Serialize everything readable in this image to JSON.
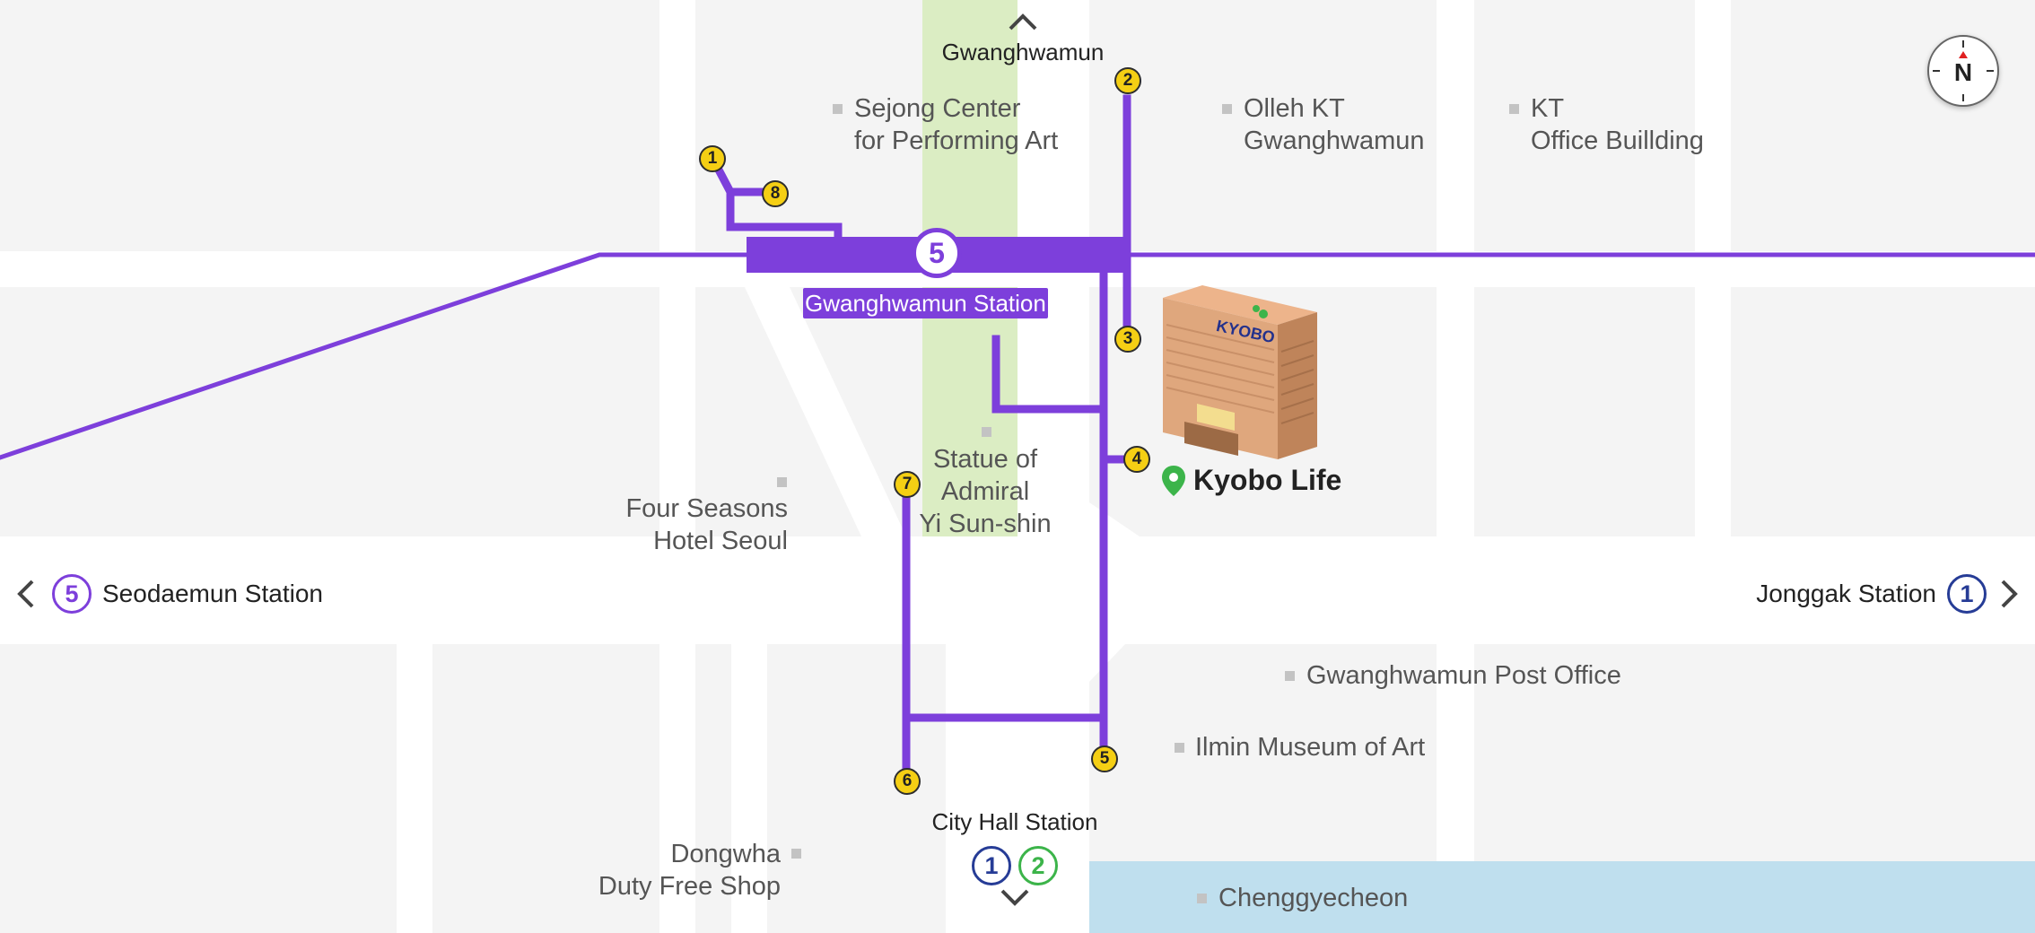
{
  "colors": {
    "line5": "#7d3fdb",
    "line1": "#263c96",
    "line2": "#3cb44a",
    "exit_fill": "#f5cf14",
    "park": "#dbedc3",
    "river": "#bfdfee",
    "road": "#ffffff",
    "block": "#f4f4f4",
    "pin": "#3cb44a"
  },
  "map": {
    "north_label": "N",
    "station": {
      "line": "5",
      "name": "Gwanghwamun Station"
    },
    "target": {
      "name": "Kyobo Life",
      "building_sign": "KYOBO",
      "icon": "map-pin-icon"
    },
    "top_nav": {
      "label": "Gwanghwamun",
      "icon": "chevron-up-icon"
    },
    "bottom_nav": {
      "label": "City Hall Station",
      "lines": [
        "1",
        "2"
      ],
      "icon": "chevron-down-icon"
    },
    "left_nav": {
      "label": "Seodaemun Station",
      "line": "5",
      "icon": "chevron-left-icon"
    },
    "right_nav": {
      "label": "Jonggak Station",
      "line": "1",
      "icon": "chevron-right-icon"
    },
    "exits": [
      "1",
      "2",
      "3",
      "4",
      "5",
      "6",
      "7",
      "8"
    ],
    "landmarks": [
      {
        "name": "Sejong Center",
        "name2": "for Performing Art"
      },
      {
        "name": "Olleh KT",
        "name2": "Gwanghwamun"
      },
      {
        "name": "KT",
        "name2": "Office Buillding"
      },
      {
        "name": "Statue of",
        "name2": "Admiral",
        "name3": "Yi Sun-shin"
      },
      {
        "name": "Four Seasons",
        "name2": "Hotel Seoul"
      },
      {
        "name": "Gwanghwamun Post Office"
      },
      {
        "name": "Ilmin Museum of Art"
      },
      {
        "name": "Dongwha",
        "name2": "Duty Free Shop"
      },
      {
        "name": "Chenggyecheon"
      }
    ]
  }
}
